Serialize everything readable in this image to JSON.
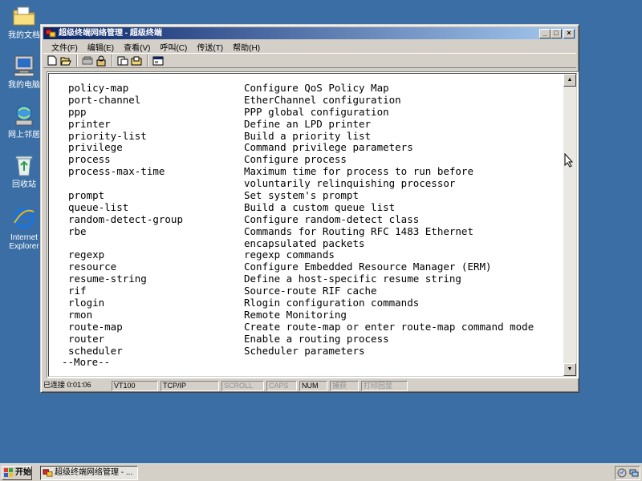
{
  "desktop": {
    "icons": [
      {
        "label": "我的文档"
      },
      {
        "label": "我的电脑"
      },
      {
        "label": "网上邻居"
      },
      {
        "label": "回收站"
      },
      {
        "label": "Internet",
        "label2": "Explorer"
      }
    ]
  },
  "window": {
    "title": "超级终端网络管理 - 超级终端",
    "controls": {
      "minimize": "_",
      "maximize": "□",
      "close": "×"
    },
    "menu": [
      "文件(F)",
      "编辑(E)",
      "查看(V)",
      "呼叫(C)",
      "传送(T)",
      "帮助(H)"
    ],
    "toolbar_icons": [
      "new-icon",
      "open-icon",
      "disconnect-icon",
      "connect-icon",
      "send-icon",
      "receive-icon",
      "properties-icon"
    ]
  },
  "terminal": {
    "lines": [
      {
        "cmd": "policy-map",
        "desc": "Configure QoS Policy Map"
      },
      {
        "cmd": "port-channel",
        "desc": "EtherChannel configuration"
      },
      {
        "cmd": "ppp",
        "desc": "PPP global configuration"
      },
      {
        "cmd": "printer",
        "desc": "Define an LPD printer"
      },
      {
        "cmd": "priority-list",
        "desc": "Build a priority list"
      },
      {
        "cmd": "privilege",
        "desc": "Command privilege parameters"
      },
      {
        "cmd": "process",
        "desc": "Configure process"
      },
      {
        "cmd": "process-max-time",
        "desc": "Maximum time for process to run before"
      },
      {
        "cmd": "",
        "desc": "voluntarily relinquishing processor"
      },
      {
        "cmd": "prompt",
        "desc": "Set system's prompt"
      },
      {
        "cmd": "queue-list",
        "desc": "Build a custom queue list"
      },
      {
        "cmd": "random-detect-group",
        "desc": "Configure random-detect class"
      },
      {
        "cmd": "rbe",
        "desc": "Commands for Routing RFC 1483 Ethernet"
      },
      {
        "cmd": "",
        "desc": "encapsulated packets"
      },
      {
        "cmd": "regexp",
        "desc": "regexp commands"
      },
      {
        "cmd": "resource",
        "desc": "Configure Embedded Resource Manager (ERM)"
      },
      {
        "cmd": "resume-string",
        "desc": "Define a host-specific resume string"
      },
      {
        "cmd": "rif",
        "desc": "Source-route RIF cache"
      },
      {
        "cmd": "rlogin",
        "desc": "Rlogin configuration commands"
      },
      {
        "cmd": "rmon",
        "desc": "Remote Monitoring"
      },
      {
        "cmd": "route-map",
        "desc": "Create route-map or enter route-map command mode"
      },
      {
        "cmd": "router",
        "desc": "Enable a routing process"
      },
      {
        "cmd": "scheduler",
        "desc": "Scheduler parameters"
      }
    ],
    "more_prompt": "--More--"
  },
  "statusbar": {
    "connected": "已连接 0:01:06",
    "emulation": "VT100",
    "protocol": "TCP/IP",
    "scroll": "SCROLL",
    "caps": "CAPS",
    "num": "NUM",
    "capture": "捕获",
    "print_echo": "打印回显"
  },
  "taskbar": {
    "start_label": "开始",
    "task_label": "超级终端网络管理 - ..."
  }
}
